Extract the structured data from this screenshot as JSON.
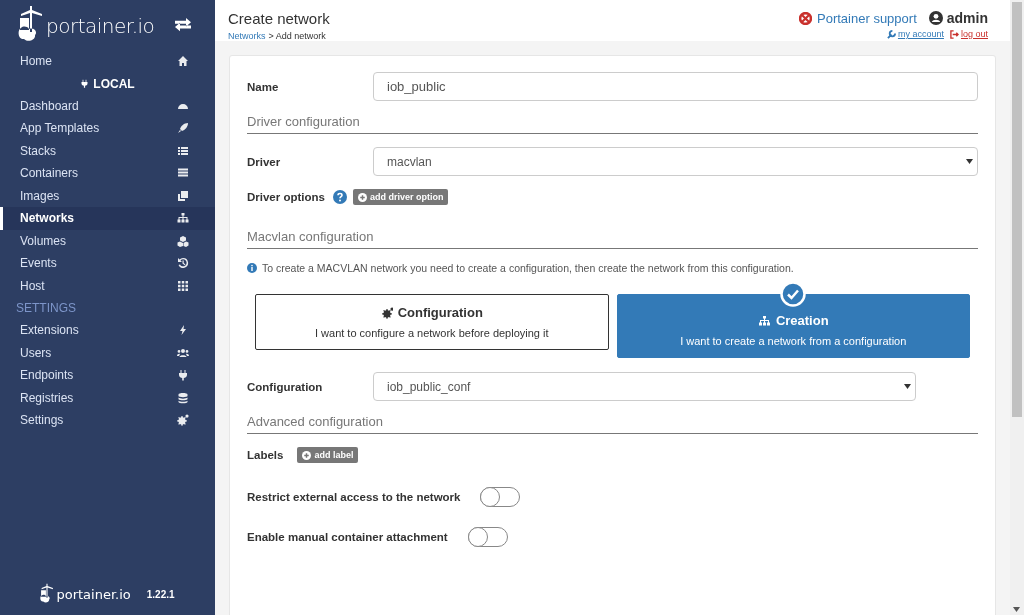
{
  "sidebar": {
    "logo": "portainer.io",
    "items": [
      {
        "kind": "item",
        "label": "Home",
        "selected": false
      },
      {
        "kind": "endpoint",
        "label": "LOCAL"
      },
      {
        "kind": "item",
        "label": "Dashboard",
        "selected": false
      },
      {
        "kind": "item",
        "label": "App Templates",
        "selected": false
      },
      {
        "kind": "item",
        "label": "Stacks",
        "selected": false
      },
      {
        "kind": "item",
        "label": "Containers",
        "selected": false
      },
      {
        "kind": "item",
        "label": "Images",
        "selected": false
      },
      {
        "kind": "item",
        "label": "Networks",
        "selected": true
      },
      {
        "kind": "item",
        "label": "Volumes",
        "selected": false
      },
      {
        "kind": "item",
        "label": "Events",
        "selected": false
      },
      {
        "kind": "item",
        "label": "Host",
        "selected": false
      },
      {
        "kind": "section",
        "label": "SETTINGS"
      },
      {
        "kind": "item",
        "label": "Extensions",
        "selected": false
      },
      {
        "kind": "item",
        "label": "Users",
        "selected": false
      },
      {
        "kind": "item",
        "label": "Endpoints",
        "selected": false
      },
      {
        "kind": "item",
        "label": "Registries",
        "selected": false
      },
      {
        "kind": "item",
        "label": "Settings",
        "selected": false
      }
    ],
    "footer": {
      "logo": "portainer.io",
      "version": "1.22.1"
    }
  },
  "header": {
    "title": "Create network",
    "breadcrumb_link": "Networks",
    "breadcrumb_current": "> Add network",
    "support": "Portainer support",
    "user": "admin",
    "my_account": "my account",
    "log_out": "log out"
  },
  "form": {
    "name": {
      "label": "Name",
      "value": "iob_public"
    },
    "driver_section": "Driver configuration",
    "driver": {
      "label": "Driver",
      "value": "macvlan"
    },
    "driver_options": {
      "label": "Driver options",
      "button": "add driver option"
    },
    "macvlan_section": "Macvlan configuration",
    "info": "To create a MACVLAN network you need to create a configuration, then create the network from this configuration.",
    "options": [
      {
        "title": "Configuration",
        "description": "I want to configure a network before deploying it",
        "selected": false
      },
      {
        "title": "Creation",
        "description": "I want to create a network from a configuration",
        "selected": true
      }
    ],
    "configuration": {
      "label": "Configuration",
      "value": "iob_public_conf"
    },
    "advanced_section": "Advanced configuration",
    "labels": {
      "label": "Labels",
      "button": "add label"
    },
    "toggles": [
      {
        "label": "Restrict external access to the network",
        "on": false
      },
      {
        "label": "Enable manual container attachment",
        "on": false
      }
    ]
  }
}
